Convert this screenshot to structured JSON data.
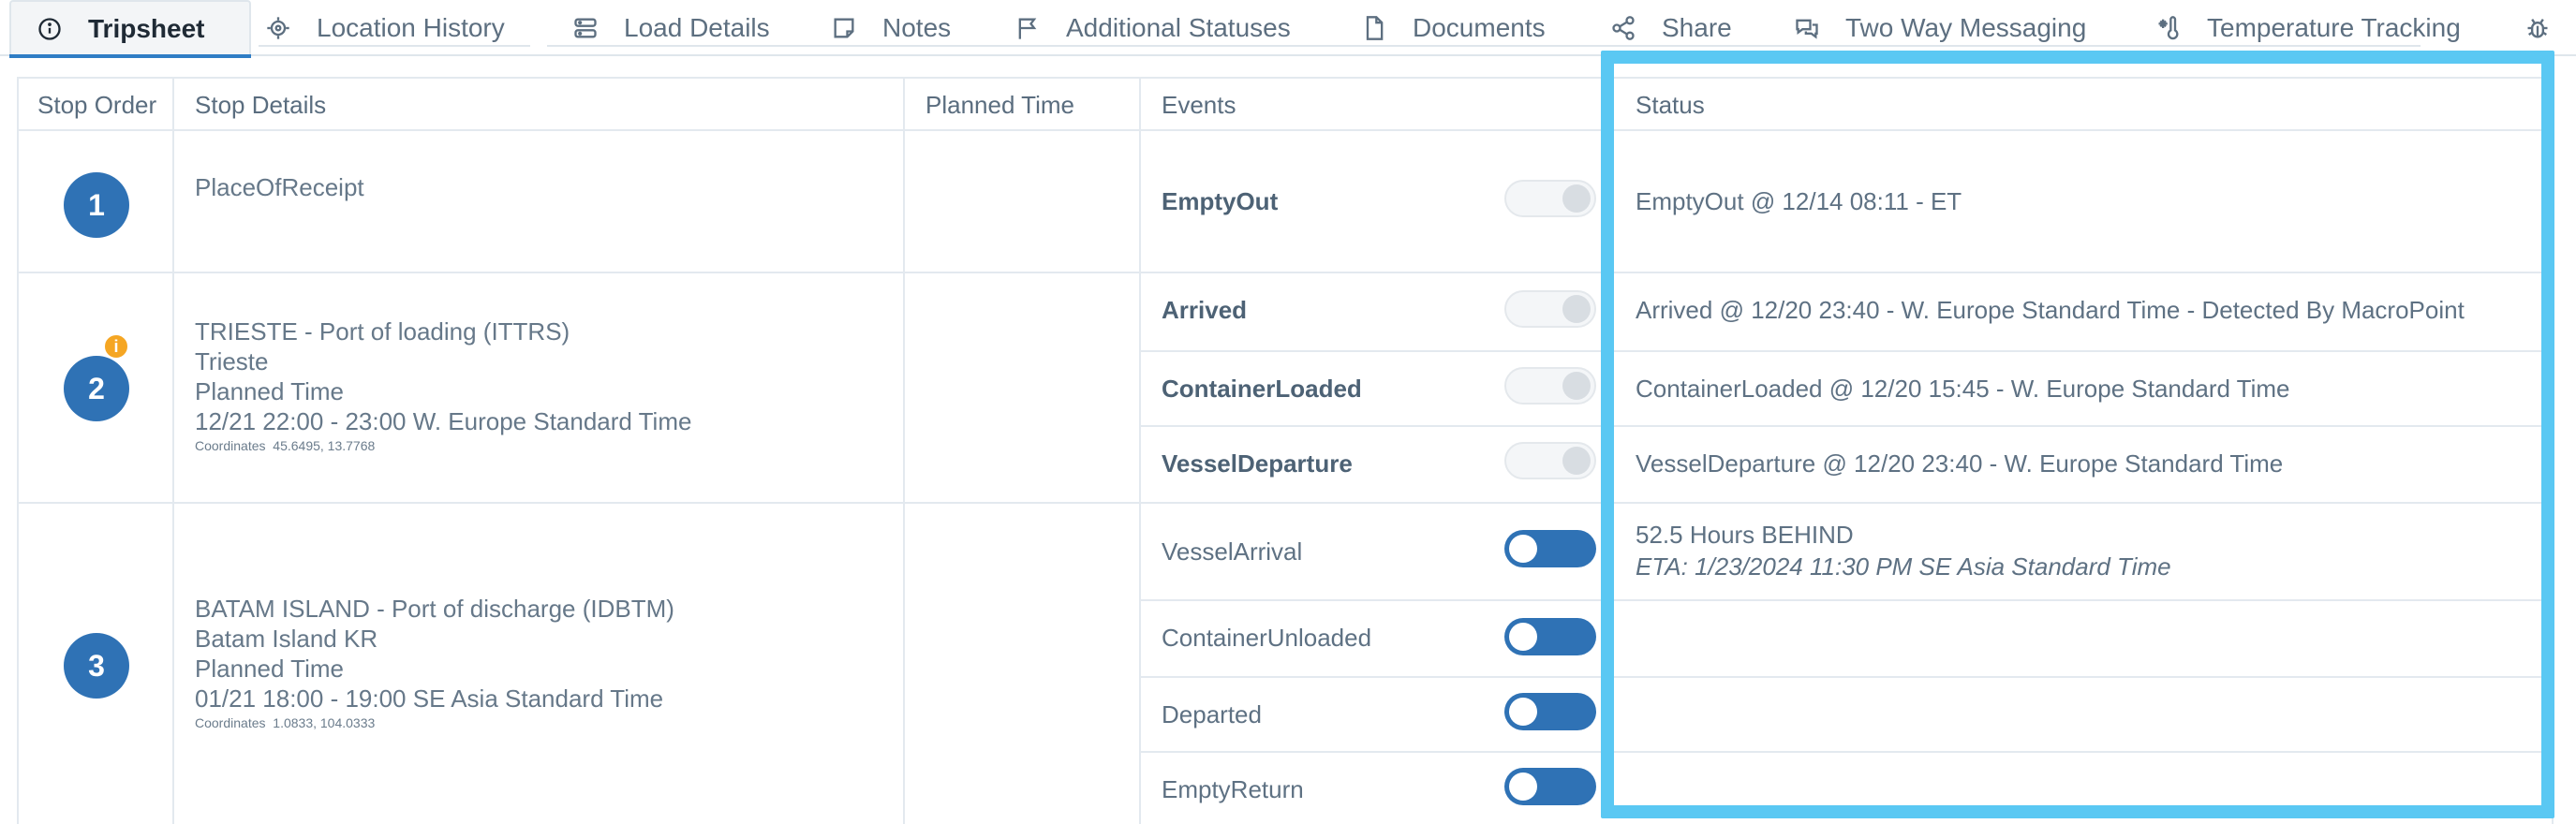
{
  "tabs": [
    {
      "label": "Tripsheet",
      "icon": "info-circle-icon",
      "active": true
    },
    {
      "label": "Location History",
      "icon": "crosshair-icon"
    },
    {
      "label": "Load Details",
      "icon": "server-icon"
    },
    {
      "label": "Notes",
      "icon": "note-icon"
    },
    {
      "label": "Additional Statuses",
      "icon": "flag-icon"
    },
    {
      "label": "Documents",
      "icon": "document-icon"
    },
    {
      "label": "Share",
      "icon": "share-icon"
    },
    {
      "label": "Two Way Messaging",
      "icon": "chat-icon"
    },
    {
      "label": "Temperature Tracking",
      "icon": "thermometer-snowflake-icon"
    }
  ],
  "table": {
    "headers": {
      "stop_order": "Stop Order",
      "stop_details": "Stop Details",
      "planned_time": "Planned Time",
      "events": "Events",
      "status": "Status"
    },
    "stops": [
      {
        "order": "1",
        "name": "PlaceOfReceipt",
        "events": [
          {
            "label": "EmptyOut",
            "toggle": "off",
            "status": "EmptyOut @ 12/14 08:11 - ET"
          }
        ]
      },
      {
        "order": "2",
        "info_badge": "i",
        "name": "TRIESTE - Port of loading (ITTRS)",
        "city": "Trieste",
        "planned_label": "Planned Time",
        "planned_window": "12/21 22:00 - 23:00 W. Europe Standard Time",
        "coords_label": "Coordinates",
        "coords": "45.6495, 13.7768",
        "events": [
          {
            "label": "Arrived",
            "toggle": "off",
            "status": "Arrived @ 12/20 23:40 - W. Europe Standard Time - Detected By MacroPoint"
          },
          {
            "label": "ContainerLoaded",
            "toggle": "off",
            "status": "ContainerLoaded @ 12/20 15:45 - W. Europe Standard Time"
          },
          {
            "label": "VesselDeparture",
            "toggle": "off",
            "status": "VesselDeparture @ 12/20 23:40 - W. Europe Standard Time"
          }
        ]
      },
      {
        "order": "3",
        "name": "BATAM ISLAND - Port of discharge (IDBTM)",
        "city": "Batam Island KR",
        "planned_label": "Planned Time",
        "planned_window": "01/21 18:00 - 19:00 SE Asia Standard Time",
        "coords_label": "Coordinates",
        "coords": "1.0833, 104.0333",
        "events": [
          {
            "label": "VesselArrival",
            "toggle": "on",
            "status": "52.5 Hours BEHIND",
            "eta": "ETA: 1/23/2024 11:30 PM SE Asia Standard Time"
          },
          {
            "label": "ContainerUnloaded",
            "toggle": "on",
            "status": ""
          },
          {
            "label": "Departed",
            "toggle": "on",
            "status": ""
          },
          {
            "label": "EmptyReturn",
            "toggle": "on",
            "status": ""
          }
        ]
      }
    ]
  },
  "colors": {
    "accent": "#2f72b5",
    "highlight": "#5ac8f3",
    "info_badge": "#f5a623"
  }
}
